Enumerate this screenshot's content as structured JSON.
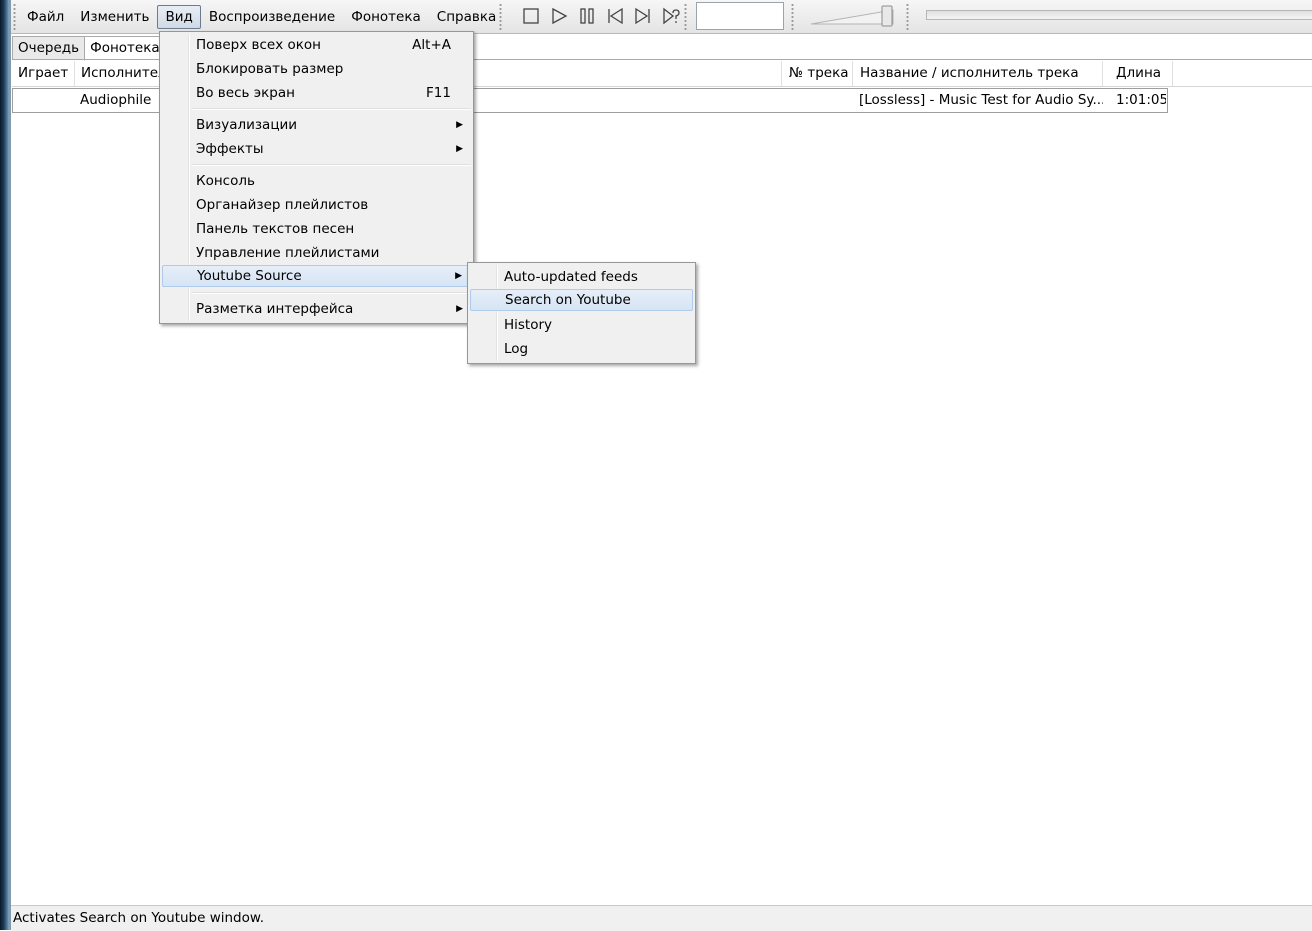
{
  "menubar": [
    "Файл",
    "Изменить",
    "Вид",
    "Воспроизведение",
    "Фонотека",
    "Справка"
  ],
  "transport_icons": [
    "stop-icon",
    "play-icon",
    "pause-icon",
    "previous-icon",
    "next-icon",
    "random-icon"
  ],
  "tabs": [
    "Очередь",
    "Фонотека"
  ],
  "columns": {
    "playing": "Играет",
    "artist": "Исполнитель",
    "track_no": "№ трека",
    "title": "Название / исполнитель трека",
    "length": "Длина"
  },
  "rows": [
    {
      "playing": "",
      "artist": "Audiophile",
      "title": "[Lossless] - Music Test for Audio Sy...",
      "length": "1:01:05"
    }
  ],
  "view_menu": {
    "items": [
      {
        "label": "Поверх всех окон",
        "shortcut": "Alt+A"
      },
      {
        "label": "Блокировать размер",
        "shortcut": ""
      },
      {
        "label": "Во весь экран",
        "shortcut": "F11"
      },
      {
        "label": "Визуализации",
        "submenu": true
      },
      {
        "label": "Эффекты",
        "submenu": true
      },
      {
        "label": "Консоль"
      },
      {
        "label": "Органайзер плейлистов"
      },
      {
        "label": "Панель текстов песен"
      },
      {
        "label": "Управление плейлистами"
      },
      {
        "label": "Youtube Source",
        "submenu": true
      },
      {
        "label": "Разметка интерфейса",
        "submenu": true
      }
    ],
    "arrow": "▶"
  },
  "youtube_menu": {
    "items": [
      "Auto-updated feeds",
      "Search on Youtube",
      "History",
      "Log"
    ],
    "highlighted": "Search on Youtube"
  },
  "status": "Activates Search on Youtube window."
}
